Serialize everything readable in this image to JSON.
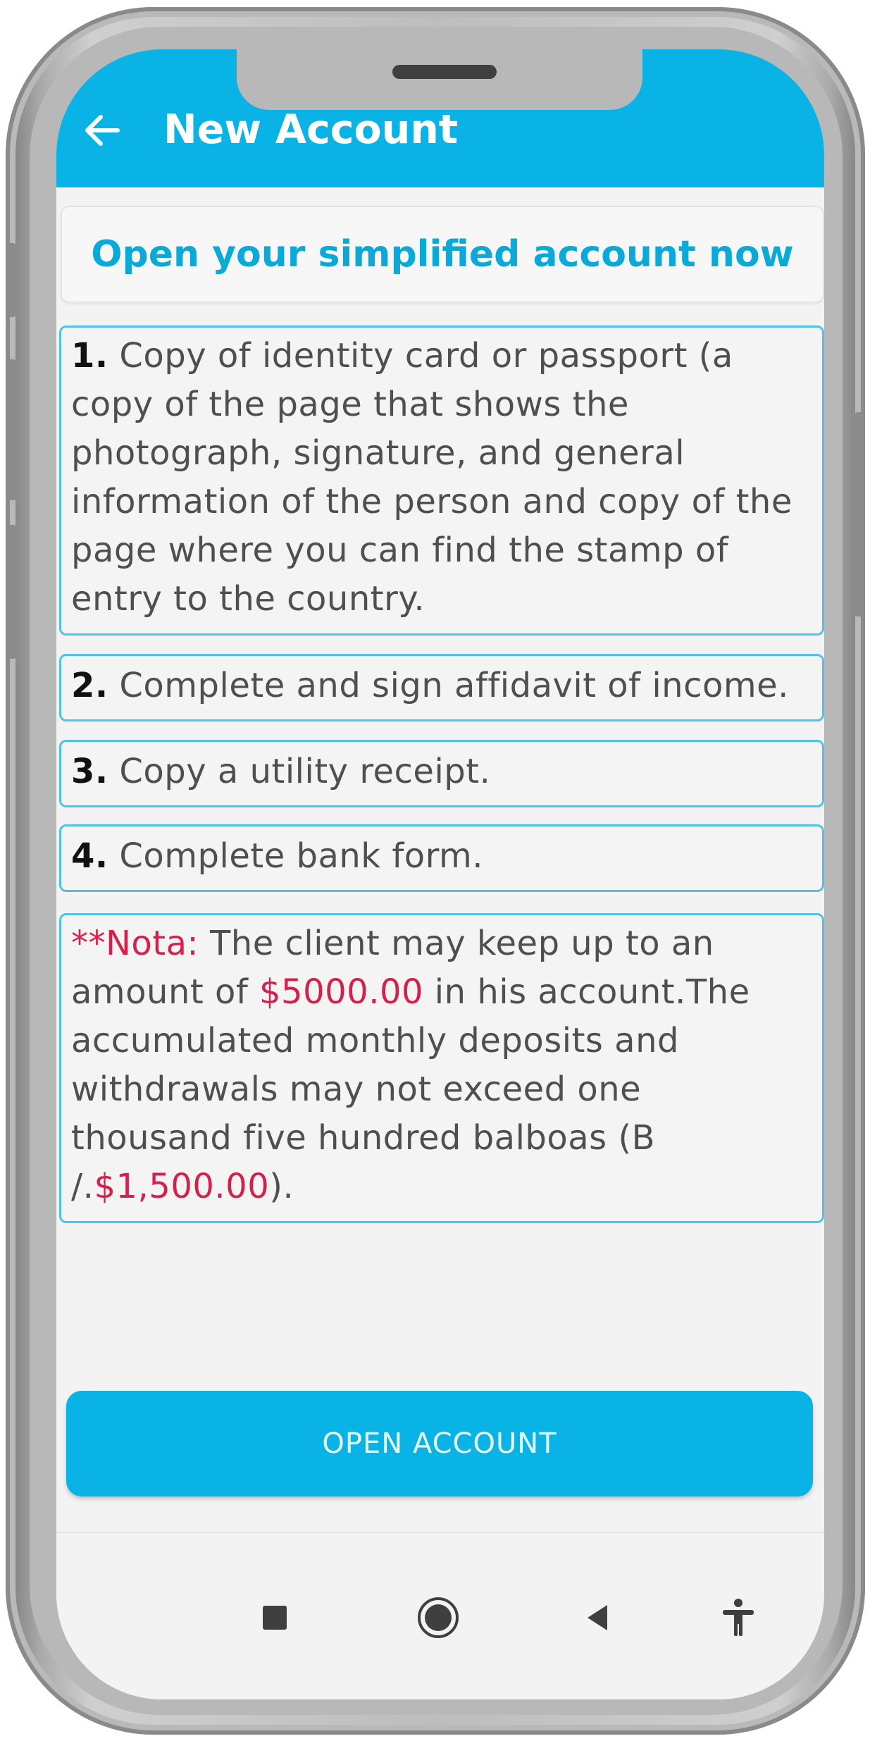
{
  "app_bar": {
    "title": "New Account",
    "back_icon": "arrow-left-icon",
    "color": "#0ab3e6"
  },
  "headline": "Open your simplified account now",
  "requirements": [
    {
      "number": "1.",
      "text": "Copy of identity card or passport (a copy of the page that shows the photograph, signature, and general information of the person and copy of the page where you can find the stamp of entry to the country."
    },
    {
      "number": "2.",
      "text": "Complete and sign affidavit of income."
    },
    {
      "number": "3.",
      "text": "Copy a utility receipt."
    },
    {
      "number": "4.",
      "text": "Complete bank form."
    }
  ],
  "note": {
    "label": "**Nota:",
    "text_1": "The client may keep up to an amount of",
    "amount_1": "$5000.00",
    "text_2": "in his account.The accumulated monthly deposits and withdrawals may not exceed one thousand five hundred balboas (B /.",
    "amount_2": "$1,500.00",
    "text_3": ").",
    "accent_color": "#d4204a"
  },
  "open_button": {
    "label": "OPEN ACCOUNT"
  },
  "nav_bar": {
    "icons": [
      "square-icon",
      "home-circle-icon",
      "back-triangle-icon",
      "accessibility-icon"
    ]
  }
}
